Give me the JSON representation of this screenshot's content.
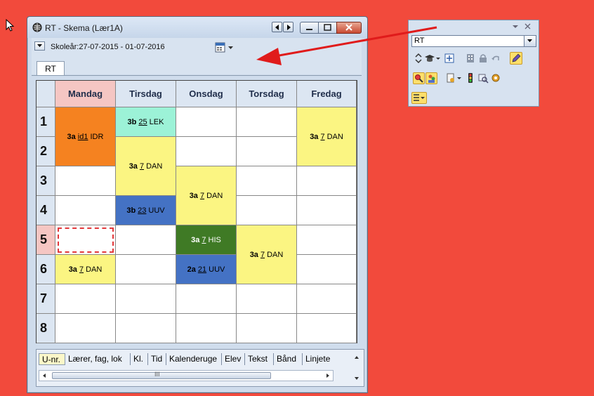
{
  "window": {
    "title": "RT -  Skema  (Lær1A)",
    "school_year": "Skoleår:27-07-2015 - 01-07-2016",
    "tab": "RT"
  },
  "schedule": {
    "days": [
      "Mandag",
      "Tirsdag",
      "Onsdag",
      "Torsdag",
      "Fredag"
    ],
    "periods": [
      "1",
      "2",
      "3",
      "4",
      "5",
      "6",
      "7",
      "8"
    ],
    "lessons": [
      {
        "day": "Mandag",
        "start": 1,
        "span": 2,
        "cls": "3a",
        "room": "id1",
        "subject": "IDR",
        "color": "#f58220"
      },
      {
        "day": "Tirsdag",
        "start": 1,
        "span": 1,
        "cls": "3b",
        "room": "25",
        "subject": "LEK",
        "color": "#9cf2d7"
      },
      {
        "day": "Tirsdag",
        "start": 2,
        "span": 2,
        "cls": "3a",
        "room": "7",
        "subject": "DAN",
        "color": "#fbf582"
      },
      {
        "day": "Tirsdag",
        "start": 4,
        "span": 1,
        "cls": "3b",
        "room": "23",
        "subject": "UUV",
        "color": "#4472c4"
      },
      {
        "day": "Onsdag",
        "start": 3,
        "span": 2,
        "cls": "3a",
        "room": "7",
        "subject": "DAN",
        "color": "#fbf582"
      },
      {
        "day": "Onsdag",
        "start": 5,
        "span": 1,
        "cls": "3a",
        "room": "7",
        "subject": "HIS",
        "color": "#3f7a25"
      },
      {
        "day": "Onsdag",
        "start": 6,
        "span": 1,
        "cls": "2a",
        "room": "21",
        "subject": "UUV",
        "color": "#4472c4"
      },
      {
        "day": "Torsdag",
        "start": 5,
        "span": 2,
        "cls": "3a",
        "room": "7",
        "subject": "DAN",
        "color": "#fbf582"
      },
      {
        "day": "Fredag",
        "start": 1,
        "span": 2,
        "cls": "3a",
        "room": "7",
        "subject": "DAN",
        "color": "#fbf582"
      },
      {
        "day": "Mandag",
        "start": 6,
        "span": 1,
        "cls": "3a",
        "room": "7",
        "subject": "DAN",
        "color": "#fbf582"
      }
    ],
    "selected_cell": {
      "day": "Mandag",
      "period": 5
    }
  },
  "bottom_tabs": [
    "U-nr.",
    "Lærer, fag, lok",
    "Kl.",
    "Tid",
    "Kalenderuge",
    "Elev",
    "Tekst",
    "Bånd",
    "Linjete"
  ],
  "bottom_tabs_active": "U-nr.",
  "scroll_mid": "III",
  "toolbar": {
    "input_value": "RT"
  },
  "colors": {
    "background": "#f24a3c",
    "arrow": "#e01b1b"
  }
}
